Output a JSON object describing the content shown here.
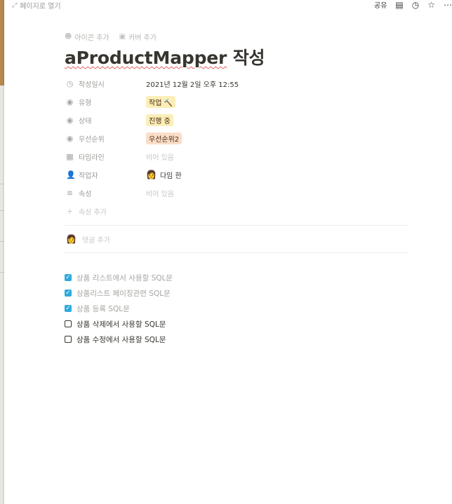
{
  "topbar": {
    "open_page_label": "페이지로 열기",
    "share_label": "공유"
  },
  "page": {
    "add_icon_label": "아이콘 추가",
    "add_cover_label": "커버 추가",
    "title_en": "aProductMapper",
    "title_ko": "작성"
  },
  "properties": {
    "created": {
      "name": "작성일시",
      "value": "2021년 12월 2일 오후 12:55"
    },
    "type": {
      "name": "유형",
      "value": "작업 🔨"
    },
    "status": {
      "name": "상태",
      "value": "진행 중"
    },
    "priority": {
      "name": "우선순위",
      "value": "우선순위2"
    },
    "timeline": {
      "name": "타임라인",
      "value": "비어 있음"
    },
    "assignee": {
      "name": "작업자",
      "value": "다임 한"
    },
    "attribute": {
      "name": "속성",
      "value": "비어 있음"
    },
    "add_property_label": "속성 추가"
  },
  "comment": {
    "placeholder": "댓글 추가"
  },
  "checklist": [
    {
      "text": "상품 리스트에서 사용할 SQL문",
      "checked": true
    },
    {
      "text": "상품리스트 페이징관련 SQL문",
      "checked": true
    },
    {
      "text": "상품 등록 SQL문",
      "checked": true
    },
    {
      "text": "상품 삭제에서 사용할 SQL문",
      "checked": false
    },
    {
      "text": "상품 수정에서 사용할 SQL문",
      "checked": false
    }
  ],
  "colors": {
    "checkbox_checked": "#2eaadc",
    "tag_yellow": "#fbeeb8",
    "tag_orange": "#fadec9",
    "text_muted": "#9b9a97"
  },
  "icons": {
    "open_page": "expand-arrows-icon",
    "comments": "comment-icon",
    "history": "clock-icon",
    "favorite": "star-icon",
    "more": "more-dots-icon"
  }
}
